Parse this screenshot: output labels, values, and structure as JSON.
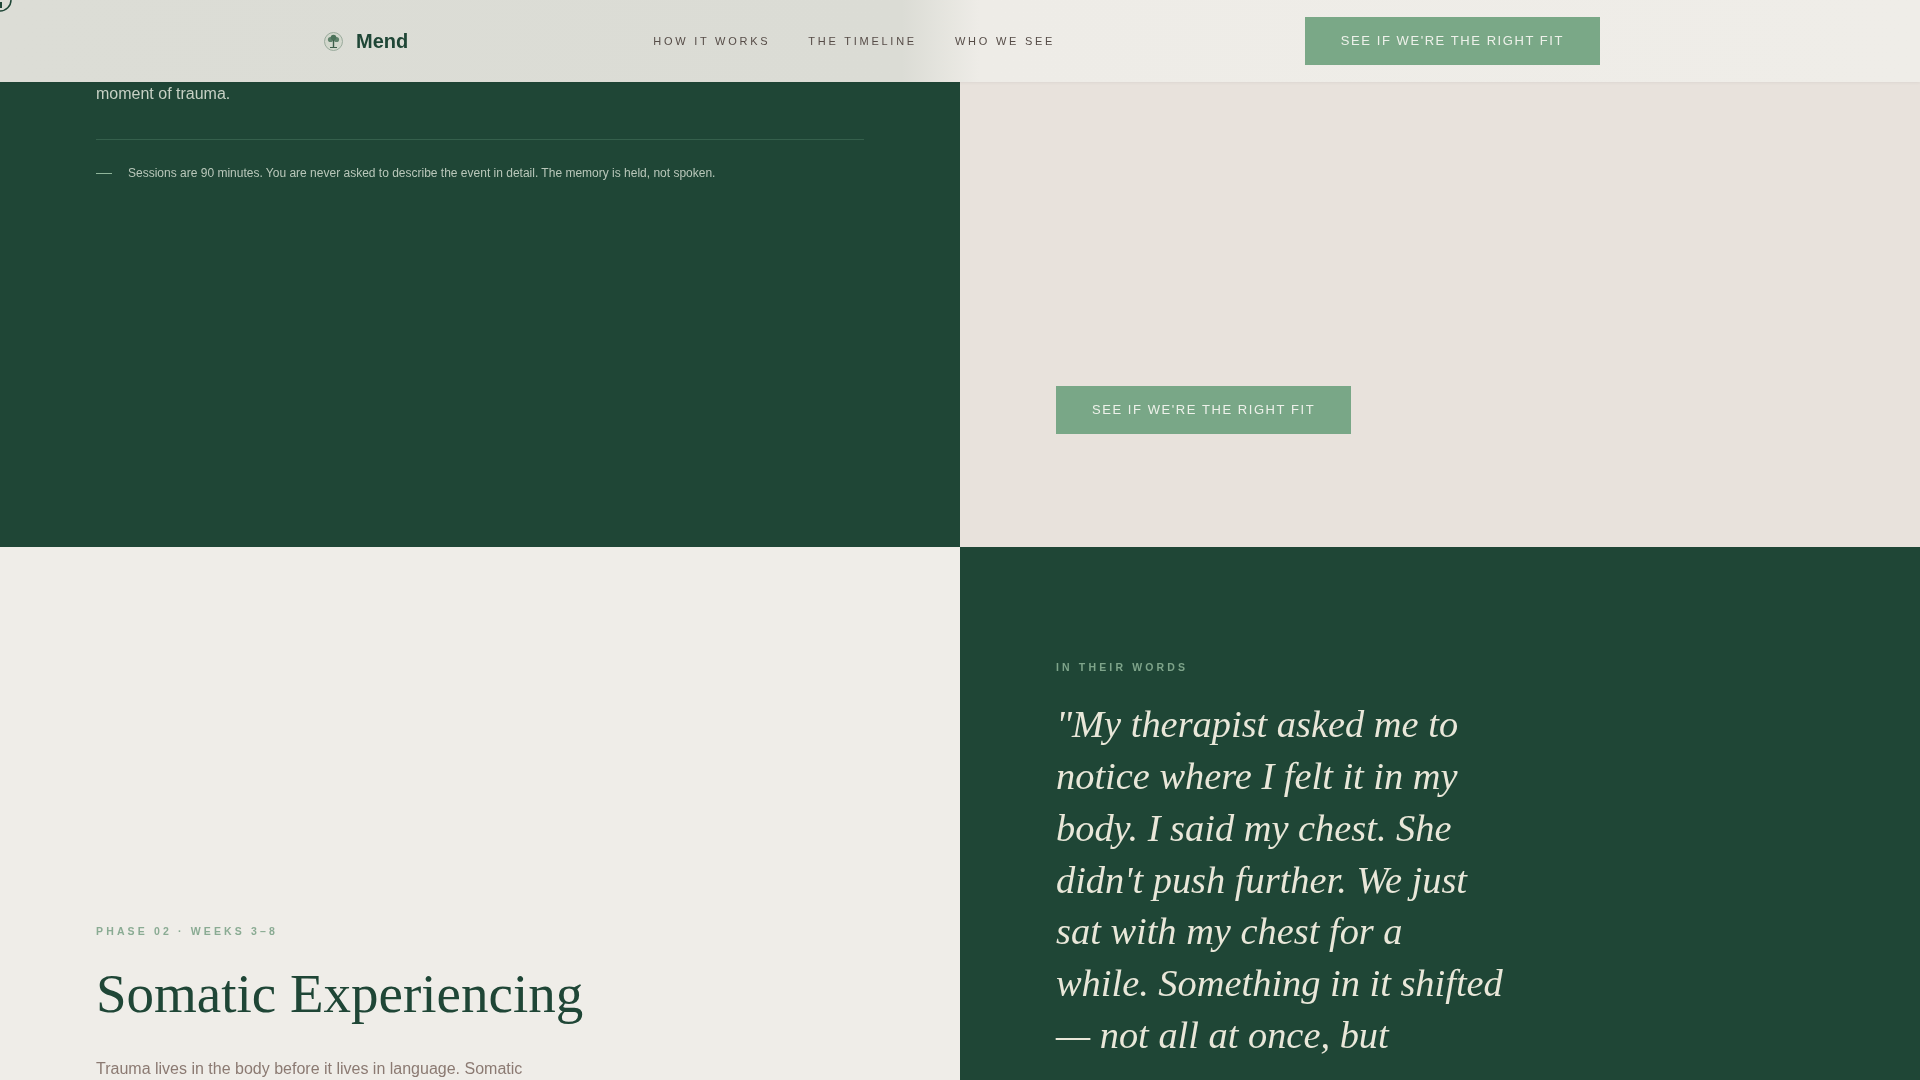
{
  "header": {
    "logo": {
      "name": "Mend"
    },
    "nav": [
      {
        "label": "HOW IT WORKS"
      },
      {
        "label": "THE TIMELINE"
      },
      {
        "label": "WHO WE SEE"
      }
    ],
    "cta": "SEE IF WE'RE THE RIGHT FIT"
  },
  "intro_panel": {
    "text_tail": "moment of trauma.",
    "note": "Sessions are 90 minutes. You are never asked to describe the event in detail. The memory is held, not spoken."
  },
  "fit_panel": {
    "button": "SEE IF WE'RE THE RIGHT FIT"
  },
  "phase": {
    "eyebrow": "PHASE 02 · WEEKS 3–8",
    "title": "Somatic Experiencing",
    "body": "Trauma lives in the body before it lives in language. Somatic"
  },
  "testimonial": {
    "eyebrow": "IN THEIR WORDS",
    "quote": "\"My therapist asked me to notice where I felt it in my body. I said my chest. She didn't push further. We just sat with my chest for a while. Something in it shifted — not all at once, but"
  }
}
